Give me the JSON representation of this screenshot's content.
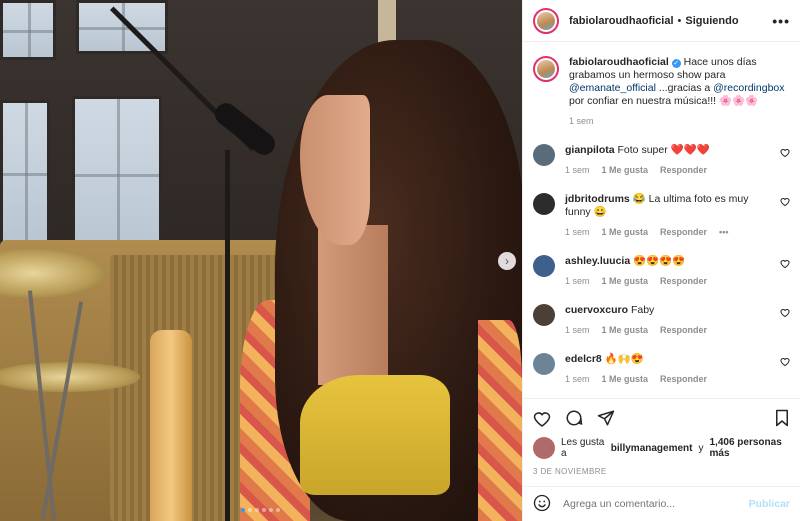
{
  "post": {
    "username": "fabiolaroudhaoficial",
    "separator": "•",
    "follow_status": "Siguiendo",
    "more_label": "•••"
  },
  "caption": {
    "username": "fabiolaroudhaoficial",
    "text_part1": "Hace unos días grabamos un hermoso show para",
    "mention1": "@emanate_official",
    "text_part2": "...gracias a",
    "mention2": "@recordingbox",
    "text_part3": "por confiar en nuestra música!!! 🌸🌸🌸",
    "time": "1 sem"
  },
  "comments": [
    {
      "username": "gianpilota",
      "text": "Foto super ❤️❤️❤️",
      "time": "1 sem",
      "likes": "1 Me gusta",
      "reply": "Responder",
      "avatar_color": "#5a6b7a",
      "more": ""
    },
    {
      "username": "jdbritodrums",
      "text": "😂 La ultima foto es muy funny 😀",
      "time": "1 sem",
      "likes": "1 Me gusta",
      "reply": "Responder",
      "avatar_color": "#2c2c2c",
      "more": "•••"
    },
    {
      "username": "ashley.luucia",
      "text": "😍😍😍😍",
      "time": "1 sem",
      "likes": "1 Me gusta",
      "reply": "Responder",
      "avatar_color": "#3f5f8c",
      "more": ""
    },
    {
      "username": "cuervoxcuro",
      "text": "Faby",
      "time": "1 sem",
      "likes": "1 Me gusta",
      "reply": "Responder",
      "avatar_color": "#4a4038",
      "more": ""
    },
    {
      "username": "edelcr8",
      "text": "🔥🙌😍",
      "time": "1 sem",
      "likes": "1 Me gusta",
      "reply": "Responder",
      "avatar_color": "#6d8396",
      "more": ""
    }
  ],
  "likes": {
    "prefix": "Les gusta a",
    "user": "billymanagement",
    "and": "y",
    "count": "1,406 personas más"
  },
  "date": "3 DE NOVIEMBRE",
  "add_comment": {
    "placeholder": "Agrega un comentario...",
    "publish": "Publicar"
  },
  "carousel": {
    "total": 6,
    "active": 0
  },
  "colors": {
    "accent": "#3897f0",
    "publish_disabled": "#b2dffc",
    "border": "#efefef"
  }
}
